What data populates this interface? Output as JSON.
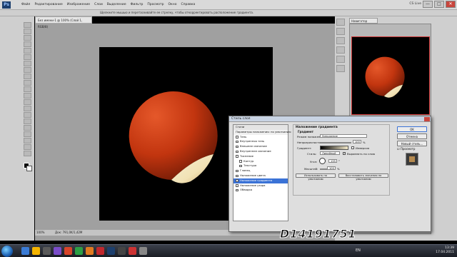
{
  "app": {
    "logo": "Ps",
    "menu": [
      "Файл",
      "Редактирование",
      "Изображение",
      "Слои",
      "Выделение",
      "Фильтр",
      "Просмотр",
      "Окно",
      "Справка"
    ],
    "cs_live": "CS Live",
    "window_buttons": [
      "—",
      "□",
      "✕"
    ]
  },
  "options_bar": {
    "hint": "Щелкните мышью и перетаскивайте ее стрелку, чтобы откорректировать расположение градиента."
  },
  "document": {
    "tab_title": "Без имени-1 @ 100% (Слой 1, RGB/8)",
    "zoom": "100%",
    "doc_info": "Док: 791,0K/1,42M"
  },
  "panels": {
    "navigator_tab": "Навигатор"
  },
  "dialog": {
    "title": "Стиль слоя",
    "styles_list": [
      {
        "label": "Стили",
        "type": "header"
      },
      {
        "label": "Параметры наложения: по умолчанию",
        "type": "header2"
      },
      {
        "label": "Тень",
        "checked": false
      },
      {
        "label": "Внутренняя тень",
        "checked": false
      },
      {
        "label": "Внешнее свечение",
        "checked": false
      },
      {
        "label": "Внутреннее свечение",
        "checked": false
      },
      {
        "label": "Тиснение",
        "checked": false
      },
      {
        "label": "Контур",
        "checked": false
      },
      {
        "label": "Текстура",
        "checked": false
      },
      {
        "label": "Глянец",
        "checked": false
      },
      {
        "label": "Наложение цвета",
        "checked": false
      },
      {
        "label": "Наложение градиента",
        "checked": true,
        "selected": true
      },
      {
        "label": "Наложение узора",
        "checked": false
      },
      {
        "label": "Обводка",
        "checked": false
      }
    ],
    "gradient_section": {
      "heading": "Наложение градиента",
      "subheading": "Градиент",
      "blend_mode_label": "Режим наложения:",
      "blend_mode_value": "Умножение",
      "opacity_label": "Непрозрачность:",
      "opacity_value": "100",
      "opacity_unit": "%",
      "gradient_label": "Градиент:",
      "reverse_label": "Инверсия",
      "style_label": "Стиль:",
      "style_value": "Линейный",
      "align_label": "Выровнять по слою",
      "angle_label": "Угол:",
      "angle_value": "135",
      "angle_unit": "°",
      "scale_label": "Масштаб:",
      "scale_value": "100",
      "scale_unit": "%",
      "default_button": "Использовать по умолчанию",
      "reset_button": "Восстановить значения по умолчанию"
    },
    "buttons": {
      "ok": "OK",
      "cancel": "Отмена",
      "new_style": "Новый стиль...",
      "preview": "Просмотр"
    }
  },
  "watermark": "D14191751",
  "taskbar": {
    "language": "EN",
    "time": "13:39",
    "date": "17.04.2011"
  },
  "colors": {
    "sphere_core": "#d5401a",
    "sphere_edge": "#7a1d08",
    "curl_light": "#f6ebc8",
    "selection_blue": "#3a72d6"
  }
}
